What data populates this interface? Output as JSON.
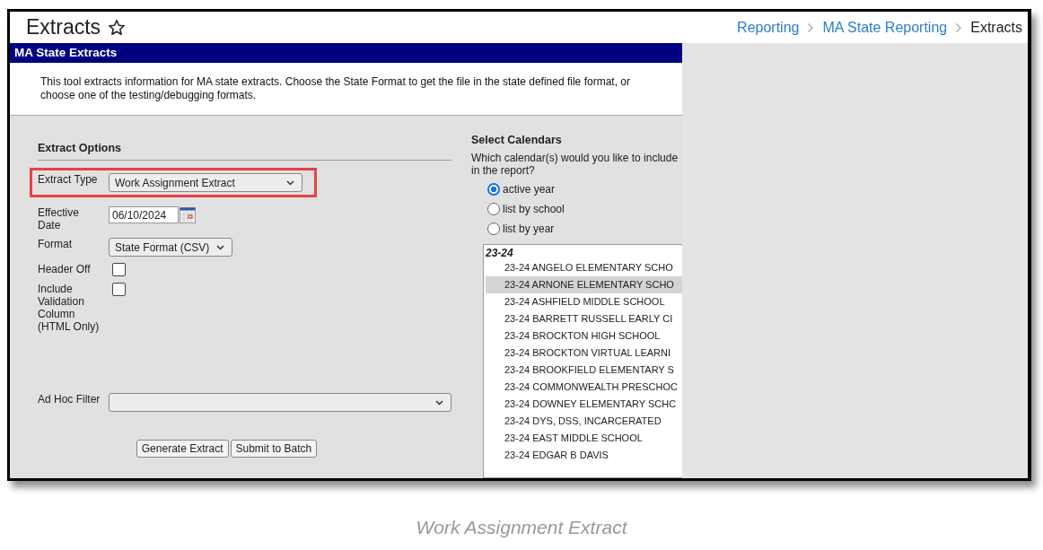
{
  "page": {
    "title": "Extracts",
    "breadcrumbs": [
      {
        "label": "Reporting",
        "current": false
      },
      {
        "label": "MA State Reporting",
        "current": false
      },
      {
        "label": "Extracts",
        "current": true
      }
    ]
  },
  "panel": {
    "title": "MA State Extracts",
    "description": "This tool extracts information for MA state extracts. Choose the State Format to get the file in the state defined file format, or choose one of the testing/debugging formats."
  },
  "extract_options": {
    "heading": "Extract Options",
    "fields": [
      {
        "kind": "select",
        "label": "Extract Type",
        "value": "Work Assignment Extract",
        "highlighted": true
      },
      {
        "kind": "date",
        "label": "Effective Date",
        "value": "06/10/2024",
        "highlighted": false
      },
      {
        "kind": "select",
        "label": "Format",
        "value": "State Format (CSV)",
        "highlighted": false
      },
      {
        "kind": "checkbox",
        "label": "Header Off",
        "checked": false,
        "highlighted": false
      },
      {
        "kind": "checkbox",
        "label": "Include Validation Column (HTML Only)",
        "checked": false,
        "highlighted": false
      },
      {
        "kind": "wideselect",
        "label": "Ad Hoc Filter",
        "highlighted": false
      }
    ],
    "buttons": [
      "Generate Extract",
      "Submit to Batch"
    ]
  },
  "select_calendars": {
    "heading": "Select Calendars",
    "question": "Which calendar(s) would you like to include in the report?",
    "options": [
      {
        "label": "active year",
        "selected": true
      },
      {
        "label": "list by school",
        "selected": false
      },
      {
        "label": "list by year",
        "selected": false
      }
    ],
    "group": "23-24",
    "calendars": [
      {
        "label": "23-24 ANGELO ELEMENTARY SCHO",
        "selected": false
      },
      {
        "label": "23-24 ARNONE ELEMENTARY SCHO",
        "selected": true
      },
      {
        "label": "23-24 ASHFIELD MIDDLE SCHOOL",
        "selected": false
      },
      {
        "label": "23-24 BARRETT RUSSELL EARLY CI",
        "selected": false
      },
      {
        "label": "23-24 BROCKTON HIGH SCHOOL",
        "selected": false
      },
      {
        "label": "23-24 BROCKTON VIRTUAL LEARNI",
        "selected": false
      },
      {
        "label": "23-24 BROOKFIELD ELEMENTARY S",
        "selected": false
      },
      {
        "label": "23-24 COMMONWEALTH PRESCHOC",
        "selected": false
      },
      {
        "label": "23-24 DOWNEY ELEMENTARY SCHC",
        "selected": false
      },
      {
        "label": "23-24 DYS, DSS, INCARCERATED",
        "selected": false
      },
      {
        "label": "23-24 EAST MIDDLE SCHOOL",
        "selected": false
      },
      {
        "label": "23-24 EDGAR B DAVIS",
        "selected": false
      }
    ]
  },
  "caption": "Work Assignment Extract"
}
